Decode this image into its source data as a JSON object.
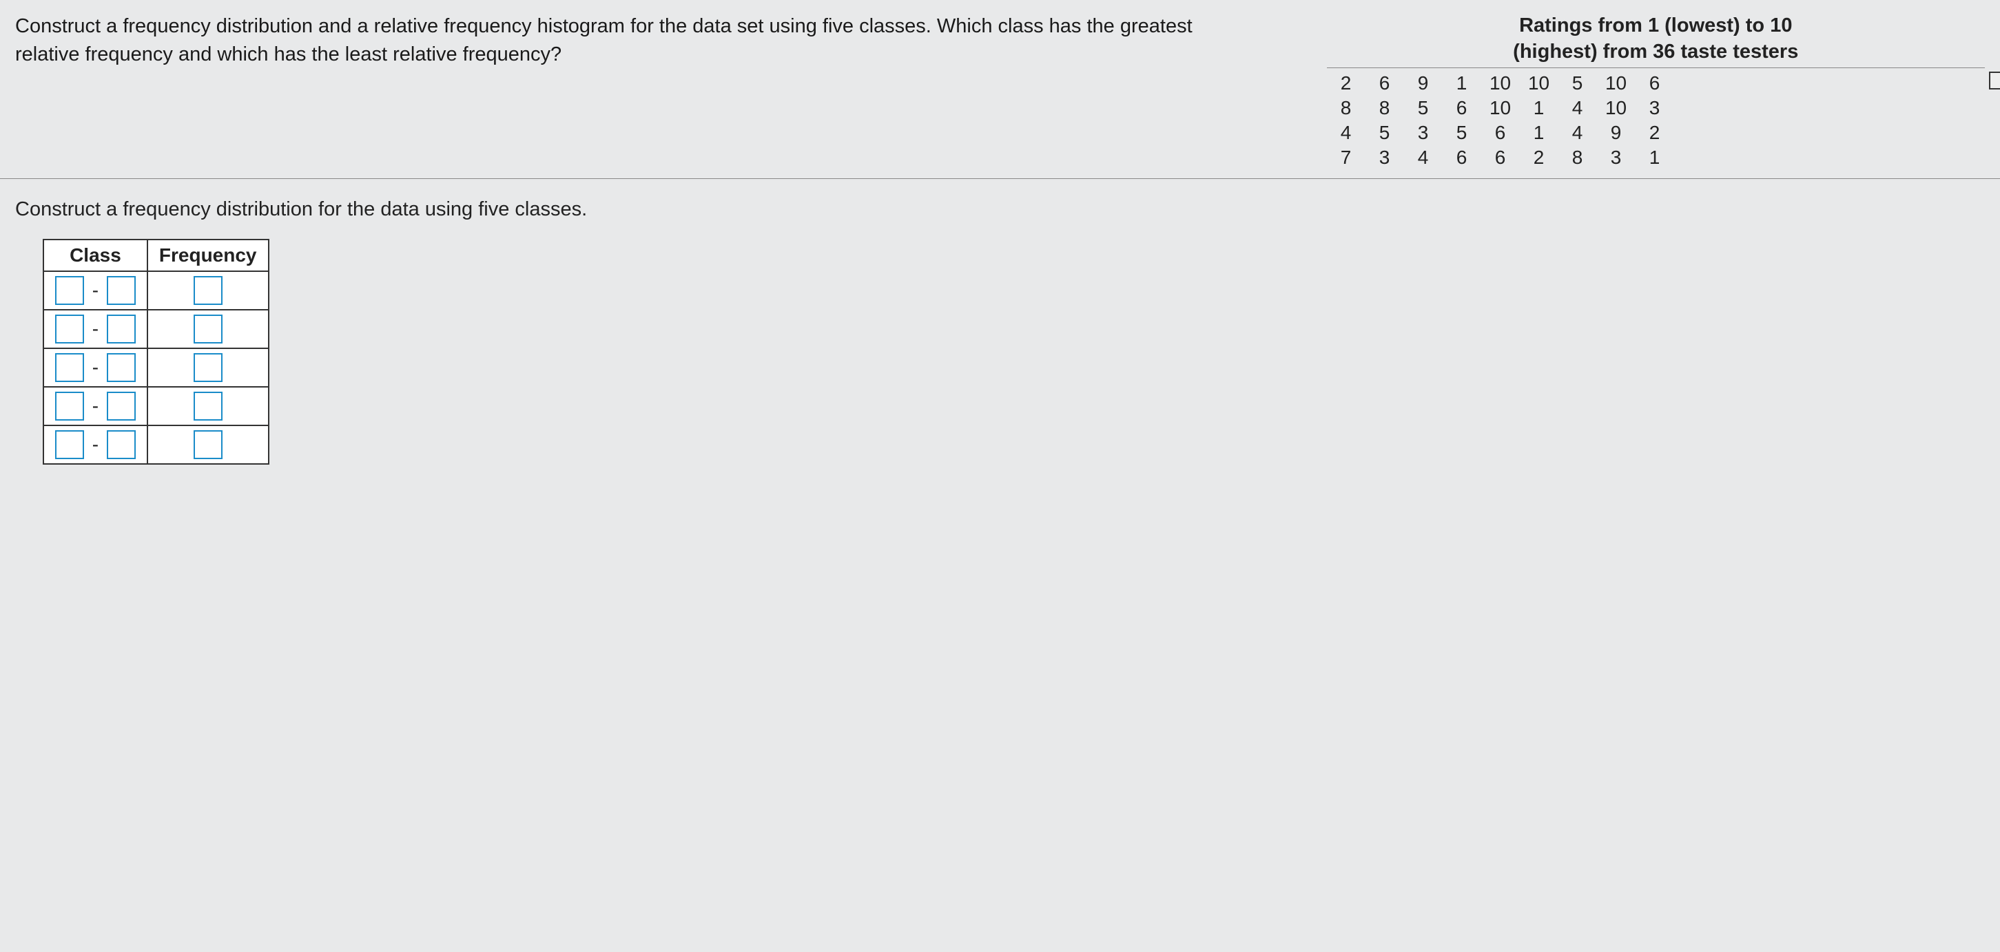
{
  "question": "Construct a frequency distribution and a relative frequency histogram for the data set using five classes. Which class has the greatest relative frequency and which has the least relative frequency?",
  "data_title_line1": "Ratings from 1 (lowest) to 10",
  "data_title_line2": "(highest) from 36 taste testers",
  "data_values": [
    [
      "2",
      "6",
      "9",
      "1",
      "10",
      "10",
      "5",
      "10",
      "6"
    ],
    [
      "8",
      "8",
      "5",
      "6",
      "10",
      "1",
      "4",
      "10",
      "3"
    ],
    [
      "4",
      "5",
      "3",
      "5",
      "6",
      "1",
      "4",
      "9",
      "2"
    ],
    [
      "7",
      "3",
      "4",
      "6",
      "6",
      "2",
      "8",
      "3",
      "1"
    ]
  ],
  "instruction": "Construct a frequency distribution for the data using five classes.",
  "table": {
    "header_class": "Class",
    "header_freq": "Frequency",
    "rows": [
      {
        "low": "",
        "high": "",
        "freq": ""
      },
      {
        "low": "",
        "high": "",
        "freq": ""
      },
      {
        "low": "",
        "high": "",
        "freq": ""
      },
      {
        "low": "",
        "high": "",
        "freq": ""
      },
      {
        "low": "",
        "high": "",
        "freq": ""
      }
    ],
    "dash": "-"
  }
}
